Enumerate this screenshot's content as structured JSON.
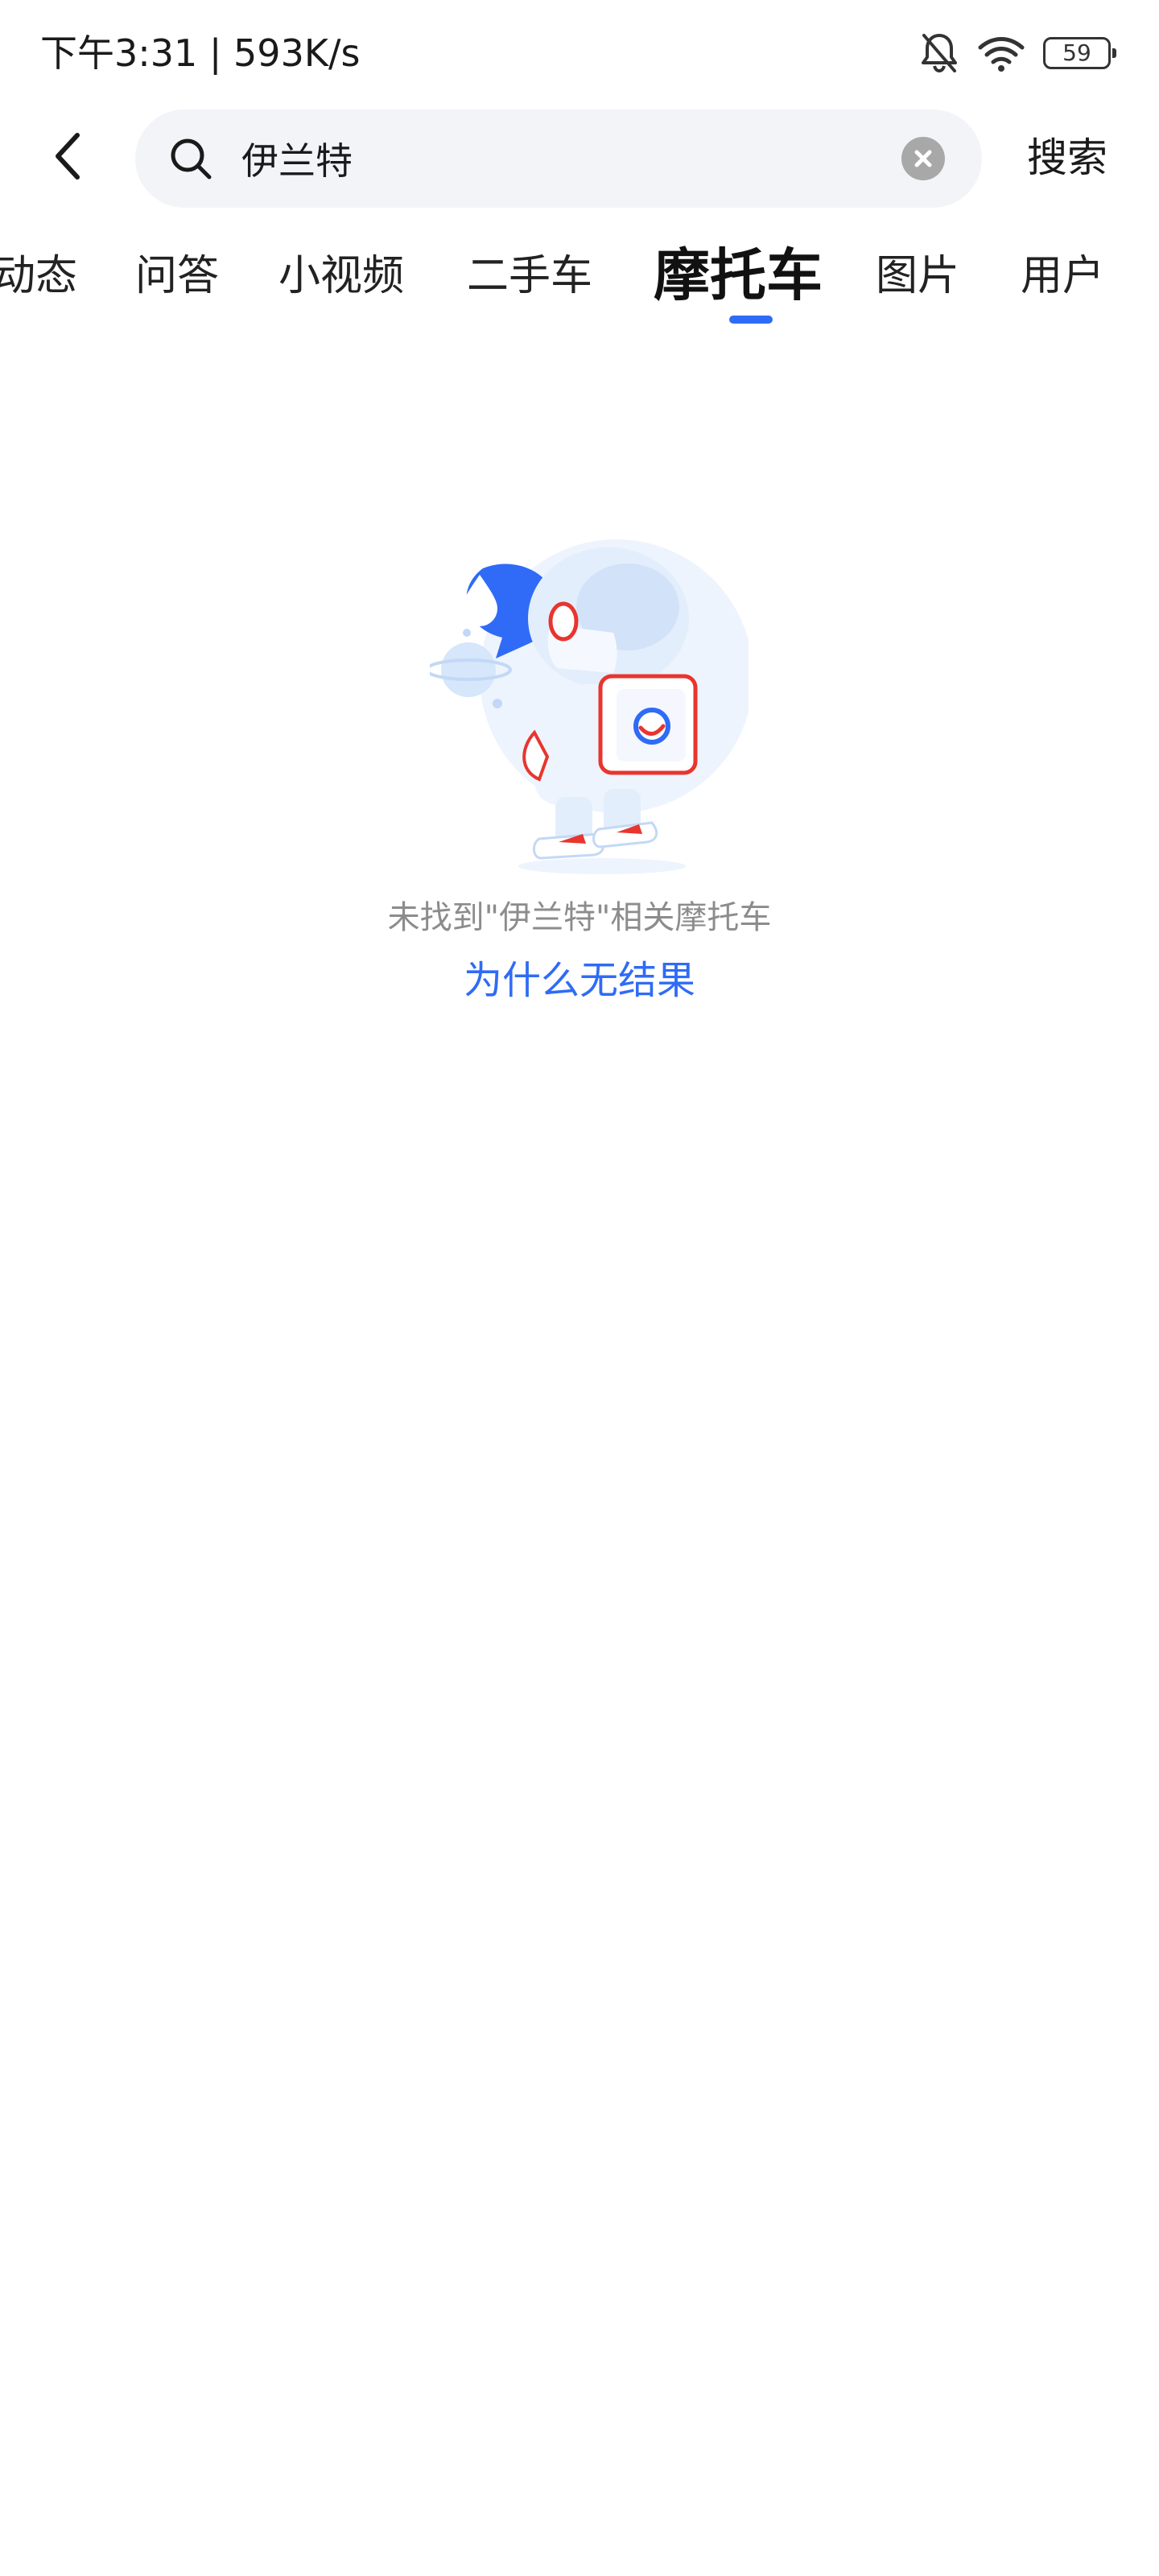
{
  "status_bar": {
    "time_speed": "下午3:31 | 593K/s",
    "battery_level": "59",
    "icons": [
      "bell-muted-icon",
      "wifi-icon",
      "battery-icon"
    ]
  },
  "search": {
    "query": "伊兰特",
    "submit_label": "搜索"
  },
  "tabs": {
    "items": [
      "动态",
      "问答",
      "小视频",
      "二手车",
      "摩托车",
      "图片",
      "用户"
    ],
    "active_index": 4
  },
  "empty_state": {
    "message": "未找到\"伊兰特\"相关摩托车",
    "link_label": "为什么无结果"
  },
  "colors": {
    "accent": "#2f6bf6",
    "search_background": "#f2f4f8",
    "muted_text": "#8c8c8c",
    "mascot_red": "#e8352e"
  }
}
